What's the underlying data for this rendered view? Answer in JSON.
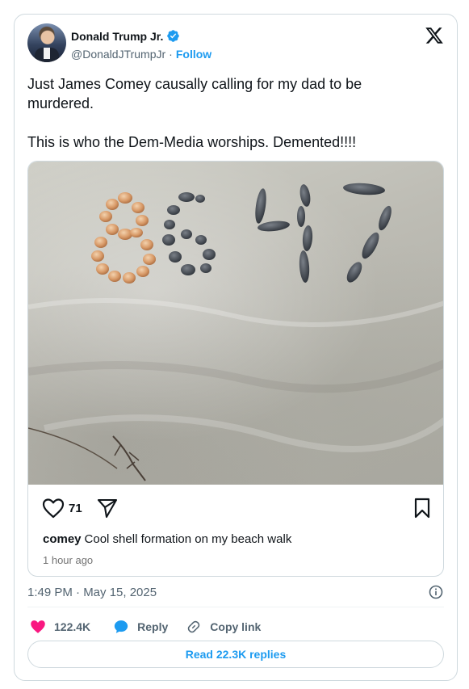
{
  "author": {
    "name": "Donald Trump Jr.",
    "handle": "@DonaldJTrumpJr",
    "separator": "·",
    "follow_label": "Follow"
  },
  "tweet": {
    "line1": "Just James Comey causally calling for my dad to be murdered.",
    "line2": "This is who the Dem-Media worships. Demented!!!!",
    "timestamp": "1:49 PM · May 15, 2025"
  },
  "embed": {
    "image_numerals": [
      "8",
      "6",
      "4",
      "7"
    ],
    "like_count": "71",
    "caption_user": "comey",
    "caption_text": "Cool shell formation on my beach walk",
    "time_ago": "1 hour ago"
  },
  "engagement": {
    "likes": "122.4K",
    "reply_label": "Reply",
    "copy_label": "Copy link",
    "read_replies_label": "Read 22.3K replies"
  },
  "colors": {
    "accent": "#1d9bf0",
    "like": "#f91880",
    "muted": "#536471",
    "border": "#cfd9de"
  },
  "icons": [
    "verified-badge-icon",
    "x-logo-icon",
    "heart-outline-icon",
    "send-icon",
    "bookmark-icon",
    "info-icon",
    "heart-filled-icon",
    "reply-bubble-icon",
    "link-icon"
  ]
}
